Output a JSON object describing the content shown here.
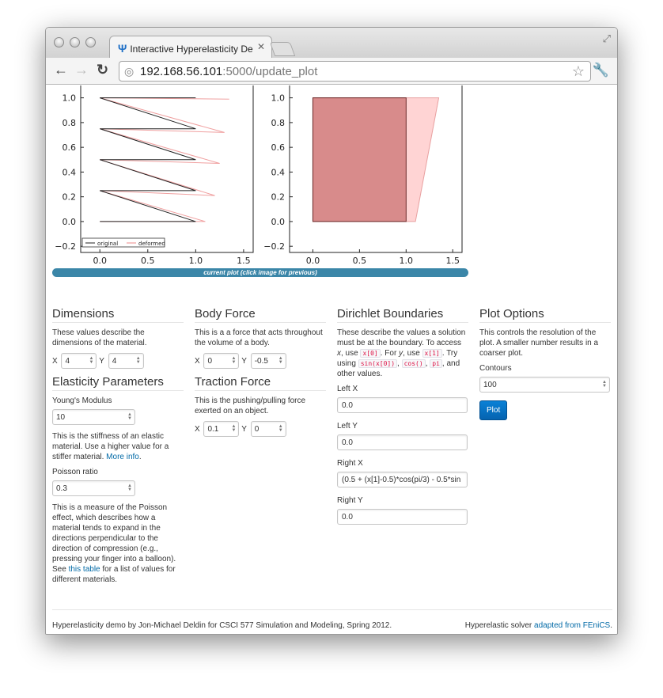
{
  "browser": {
    "tab_title": "Interactive Hyperelasticity De",
    "tab_close": "✕",
    "url_host": "192.168.56.101",
    "url_path": ":5000/update_plot"
  },
  "plot": {
    "caption": "current plot (click image for previous)",
    "y_ticks": [
      "1.0",
      "0.8",
      "0.6",
      "0.4",
      "0.2",
      "0.0",
      "−0.2"
    ],
    "x_ticks": [
      "0.0",
      "0.5",
      "1.0",
      "1.5"
    ],
    "legend_original": "original",
    "legend_deformed": "deformed"
  },
  "chart_data": [
    {
      "type": "line",
      "series": [
        {
          "name": "original",
          "x": [
            0,
            1,
            0,
            1,
            0,
            1,
            0,
            1,
            0,
            1,
            0
          ],
          "y": [
            0,
            0,
            0.25,
            0.25,
            0.5,
            0.5,
            0.75,
            0.75,
            1.0,
            1.0,
            1.0
          ]
        },
        {
          "name": "deformed",
          "x": [
            0,
            1.1,
            0,
            1.2,
            0,
            1.25,
            0,
            1.3,
            0,
            1.35
          ],
          "y": [
            0,
            0,
            0.25,
            0.21,
            0.5,
            0.47,
            0.75,
            0.72,
            1.0,
            0.99
          ]
        }
      ],
      "xlim": [
        -0.2,
        1.6
      ],
      "ylim": [
        -0.25,
        1.1
      ],
      "legend": "bottom"
    },
    {
      "type": "area",
      "series": [
        {
          "name": "original",
          "x": [
            0,
            1,
            1,
            0
          ],
          "y": [
            0,
            0,
            1,
            1
          ]
        },
        {
          "name": "deformed",
          "x": [
            0,
            1.1,
            1.35,
            0
          ],
          "y": [
            0,
            0,
            1,
            1
          ]
        }
      ],
      "xlim": [
        -0.25,
        1.6
      ],
      "ylim": [
        -0.25,
        1.1
      ]
    }
  ],
  "dimensions": {
    "title": "Dimensions",
    "desc": "These values describe the dimensions of the material.",
    "x_label": "X",
    "x_value": "4",
    "y_label": "Y",
    "y_value": "4"
  },
  "elasticity": {
    "title": "Elasticity Parameters",
    "young_label": "Young's Modulus",
    "young_value": "10",
    "young_desc": "This is the stiffness of an elastic material. Use a higher value for a stiffer material.",
    "more_info": "More info",
    "poisson_label": "Poisson ratio",
    "poisson_value": "0.3",
    "poisson_desc": "This is a measure of the Poisson effect, which describes how a material tends to expand in the directions perpendicular to the direction of compression (e.g., pressing your finger into a balloon). See",
    "this_table": "this table",
    "poisson_desc2": "for a list of values for different materials."
  },
  "body_force": {
    "title": "Body Force",
    "desc": "This is a a force that acts throughout the volume of a body.",
    "x_label": "X",
    "x_value": "0",
    "y_label": "Y",
    "y_value": "-0.5"
  },
  "traction": {
    "title": "Traction Force",
    "desc": "This is the pushing/pulling force exerted on an object.",
    "x_label": "X",
    "x_value": "0.1",
    "y_label": "Y",
    "y_value": "0"
  },
  "dirichlet": {
    "title": "Dirichlet Boundaries",
    "desc1": "These describe the values a solution must be at the boundary. To access",
    "x_word": "x",
    "desc2": ", use",
    "code_x0": "x[0]",
    "desc3": ". For",
    "y_word": "y",
    "desc4": ", use",
    "code_x1": "x[1]",
    "desc5": ". Try using",
    "code_sin": "sin(x[0])",
    "code_cos": "cos()",
    "code_pi": "pi",
    "desc6": ", and other values.",
    "left_x_label": "Left X",
    "left_x_value": "0.0",
    "left_y_label": "Left Y",
    "left_y_value": "0.0",
    "right_x_label": "Right X",
    "right_x_value": "(0.5 + (x[1]-0.5)*cos(pi/3) - 0.5*sin",
    "right_y_label": "Right Y",
    "right_y_value": "0.0"
  },
  "plot_options": {
    "title": "Plot Options",
    "desc": "This controls the resolution of the plot. A smaller number results in a coarser plot.",
    "contours_label": "Contours",
    "contours_value": "100",
    "plot_button": "Plot"
  },
  "footer": {
    "left": "Hyperelasticity demo by Jon-Michael Deldin for CSCI 577 Simulation and Modeling, Spring 2012.",
    "right_prefix": "Hyperelastic solver",
    "right_link": "adapted from FEniCS",
    "right_suffix": "."
  }
}
